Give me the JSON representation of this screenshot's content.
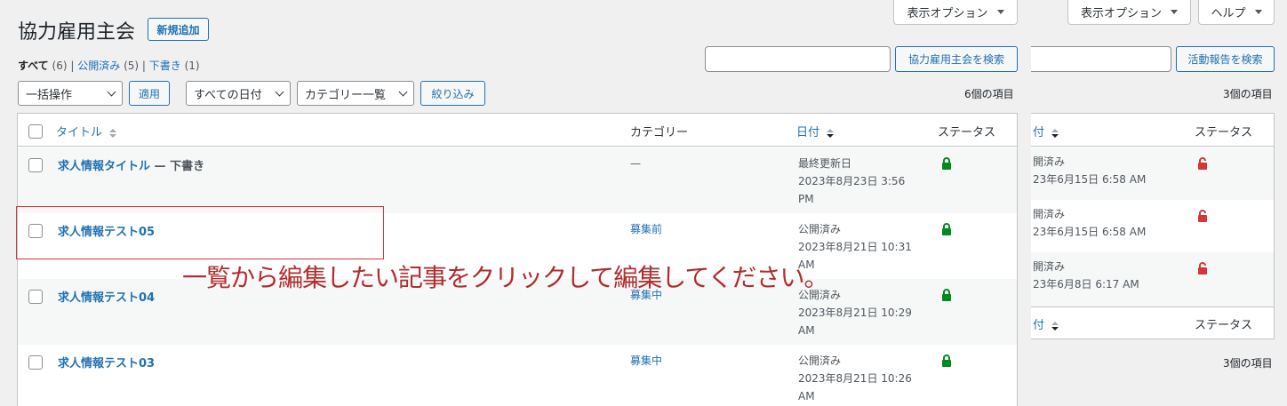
{
  "screen_options_left": "表示オプション",
  "screen_options_right": "表示オプション",
  "help_label": "ヘルプ",
  "page_title": "協力雇用主会",
  "add_new": "新規追加",
  "filters": {
    "all": "すべて",
    "all_count": "(6)",
    "sep1": "|",
    "published": "公開済み",
    "published_count": "(5)",
    "sep2": "|",
    "draft": "下書き",
    "draft_count": "(1)"
  },
  "search_left_button": "協力雇用主会を検索",
  "search_right_button": "活動報告を検索",
  "bulk_action": "一括操作",
  "apply": "適用",
  "all_dates": "すべての日付",
  "category_list": "カテゴリー一覧",
  "filter_btn": "絞り込み",
  "items_count_left": "6個の項目",
  "items_count_right": "3個の項目",
  "items_count_right_bottom": "3個の項目",
  "columns": {
    "title": "タイトル",
    "category": "カテゴリー",
    "date": "日付",
    "status": "ステータス"
  },
  "right_columns": {
    "date_partial": "付",
    "status": "ステータス"
  },
  "rows": [
    {
      "title": "求人情報タイトル",
      "state": " — 下書き",
      "category": "—",
      "date_label": "最終更新日",
      "date_line1": "2023年8月23日 3:56",
      "date_line2": "PM"
    },
    {
      "title": "求人情報テスト05",
      "state": "",
      "category": "募集前",
      "date_label": "公開済み",
      "date_line1": "2023年8月21日 10:31",
      "date_line2": "AM"
    },
    {
      "title": "求人情報テスト04",
      "state": "",
      "category": "募集中",
      "date_label": "公開済み",
      "date_line1": "2023年8月21日 10:29",
      "date_line2": "AM"
    },
    {
      "title": "求人情報テスト03",
      "state": "",
      "category": "募集中",
      "date_label": "公開済み",
      "date_line1": "2023年8月21日 10:26",
      "date_line2": "AM"
    }
  ],
  "right_rows": [
    {
      "label": "開済み",
      "date": "23年6月15日 6:58 AM"
    },
    {
      "label": "開済み",
      "date": "23年6月15日 6:58 AM"
    },
    {
      "label": "開済み",
      "date": "23年6月8日 6:17 AM"
    }
  ],
  "annotation": "一覧から編集したい記事をクリックして編集してください。",
  "colors": {
    "link": "#2271b1",
    "lock_green": "#008a20",
    "lock_red": "#d63638",
    "annotation": "#b32d2e"
  }
}
